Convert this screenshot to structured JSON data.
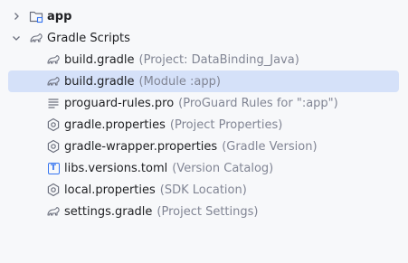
{
  "tree": {
    "app": {
      "label": "app",
      "icon": "folder-module-icon",
      "expanded": false
    },
    "gradle_scripts": {
      "label": "Gradle Scripts",
      "icon": "gradle-elephant-icon",
      "expanded": true,
      "items": [
        {
          "name": "build.gradle",
          "hint": "(Project: DataBinding_Java)",
          "icon": "gradle-elephant-icon",
          "selected": false
        },
        {
          "name": "build.gradle",
          "hint": "(Module :app)",
          "icon": "gradle-elephant-icon",
          "selected": true
        },
        {
          "name": "proguard-rules.pro",
          "hint": "(ProGuard Rules for \":app\")",
          "icon": "text-file-icon",
          "selected": false
        },
        {
          "name": "gradle.properties",
          "hint": "(Project Properties)",
          "icon": "settings-gear-icon",
          "selected": false
        },
        {
          "name": "gradle-wrapper.properties",
          "hint": "(Gradle Version)",
          "icon": "settings-gear-icon",
          "selected": false
        },
        {
          "name": "libs.versions.toml",
          "hint": "(Version Catalog)",
          "icon": "toml-file-icon",
          "toml_letter": "T",
          "selected": false
        },
        {
          "name": "local.properties",
          "hint": "(SDK Location)",
          "icon": "settings-gear-icon",
          "selected": false
        },
        {
          "name": "settings.gradle",
          "hint": "(Project Settings)",
          "icon": "gradle-elephant-icon",
          "selected": false
        }
      ]
    }
  },
  "colors": {
    "background": "#f7f8fa",
    "selection": "#d5e1f9",
    "hint_text": "#818594",
    "toml_accent": "#3574f0"
  }
}
